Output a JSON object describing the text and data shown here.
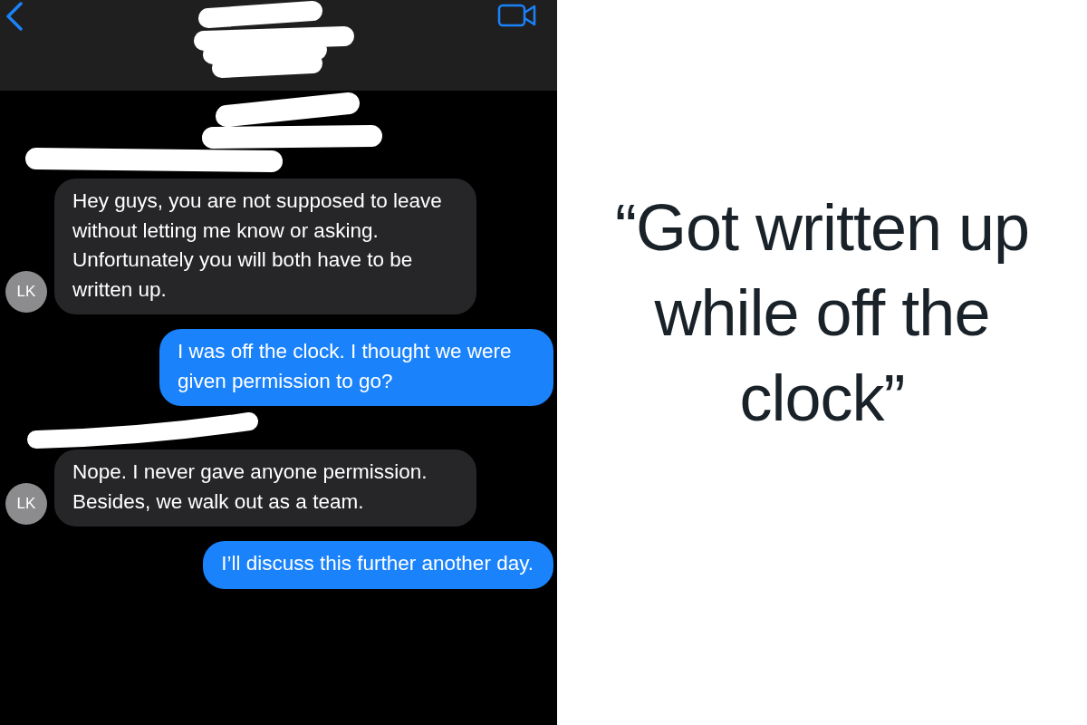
{
  "conversation": {
    "messages": [
      {
        "kind": "incoming",
        "avatar": "LK",
        "text": "Hey guys, you are not supposed to leave without letting me know or asking. Unfortunately you will both have to be written up."
      },
      {
        "kind": "outgoing",
        "text": "I was off the clock. I thought we were given permission to go?"
      },
      {
        "kind": "incoming",
        "avatar": "LK",
        "text": "Nope. I never gave anyone permission. Besides, we walk out as a team."
      },
      {
        "kind": "outgoing",
        "text": "I’ll discuss this further another day."
      }
    ]
  },
  "caption": "“Got written up while off the clock”"
}
